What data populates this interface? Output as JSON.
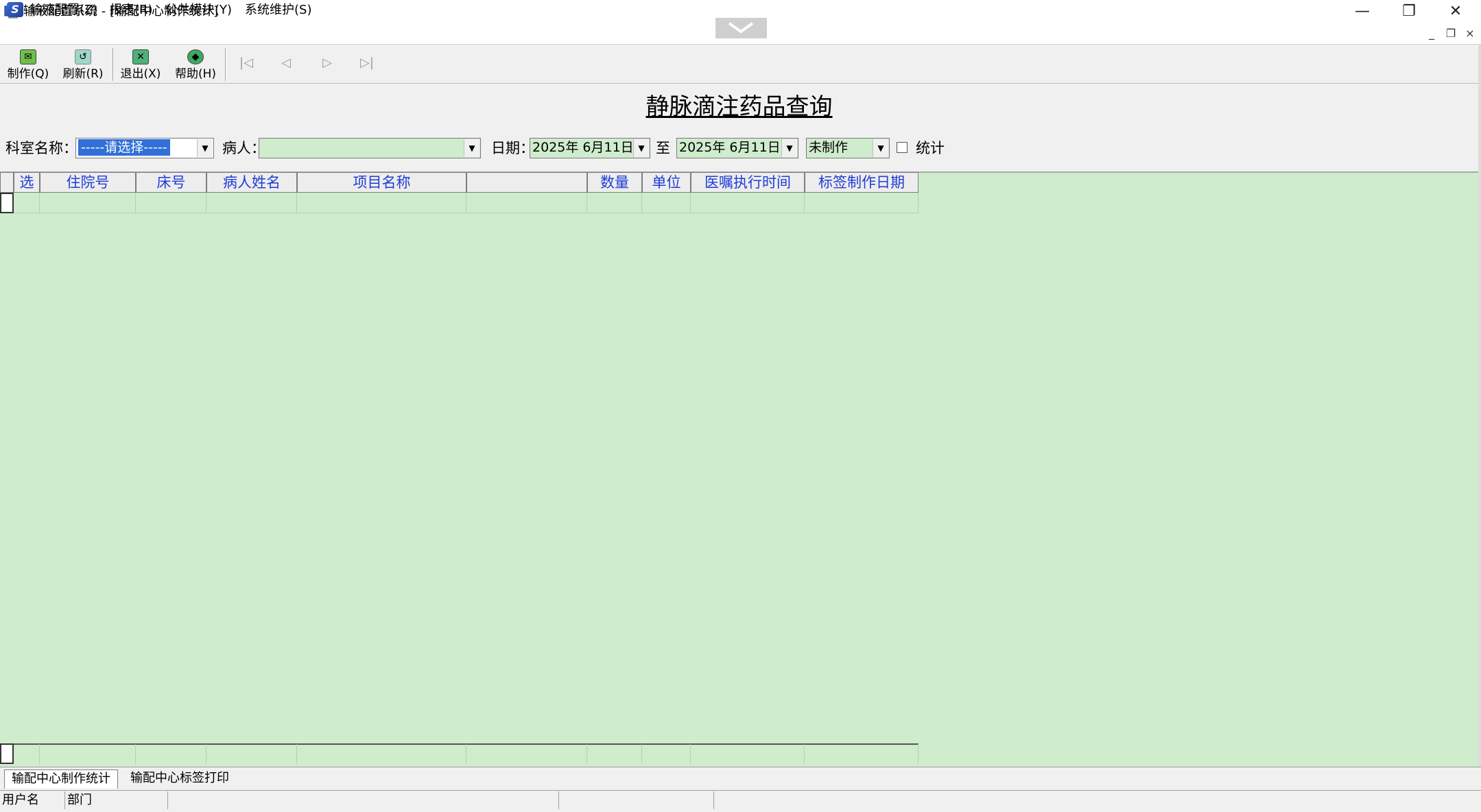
{
  "window": {
    "title": "输液配置系统 - [输配中心制作统计]",
    "minimize_glyph": "—",
    "restore_glyph": "❐",
    "close_glyph": "✕"
  },
  "menu": {
    "items": [
      "输液配置(Z)",
      "报表(R)",
      "公共模块(Y)",
      "系统维护(S)"
    ],
    "mdi_minimize": "_",
    "mdi_restore": "❐",
    "mdi_close": "×"
  },
  "toolbar": {
    "buttons": [
      {
        "label": "制作(Q)",
        "icon": "make-icon",
        "glyph": "✉"
      },
      {
        "label": "刷新(R)",
        "icon": "refresh-icon",
        "glyph": "↺"
      },
      {
        "label": "退出(X)",
        "icon": "exit-icon",
        "glyph": "✕"
      },
      {
        "label": "帮助(H)",
        "icon": "help-icon",
        "glyph": "◆"
      }
    ],
    "nav": [
      "|◁",
      "◁",
      "▷",
      "▷|"
    ]
  },
  "page_title": "静脉滴注药品查询",
  "filters": {
    "dept_label": "科室名称：",
    "dept_value": "-----请选择-----",
    "patient_label": "病人：",
    "patient_value": "",
    "date_label": "日期：",
    "date_from": "2025年 6月11日",
    "to_label": "至",
    "date_to": "2025年 6月11日",
    "status_value": "未制作",
    "stat_label": "统计",
    "stat_checked": false
  },
  "grid": {
    "columns": [
      "选",
      "住院号",
      "床号",
      "病人姓名",
      "项目名称",
      "",
      "数量",
      "单位",
      "医嘱执行时间",
      "标签制作日期"
    ]
  },
  "tabs": [
    "输配中心制作统计",
    "输配中心标签打印"
  ],
  "status": {
    "user_label": "用户名",
    "dept_label": "部门"
  },
  "colors": {
    "grid_background": "#cfeccd",
    "header_text": "#1f3cd6",
    "selection": "#3070d8"
  }
}
